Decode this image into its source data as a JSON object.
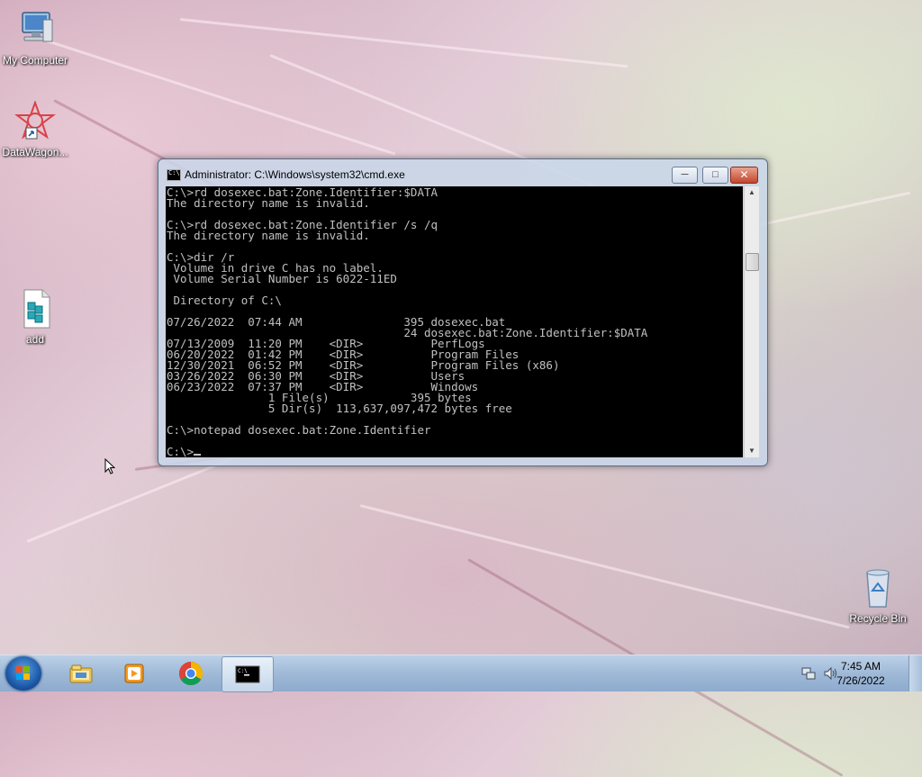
{
  "desktop": {
    "icons": [
      {
        "label": "My Computer",
        "icon": "computer-icon"
      },
      {
        "label": "DataWagon...",
        "icon": "datawagon-shortcut-icon"
      },
      {
        "label": "add",
        "icon": "registry-file-icon"
      },
      {
        "label": "Recycle Bin",
        "icon": "recycle-bin-icon"
      }
    ]
  },
  "cmd": {
    "title": "Administrator: C:\\Windows\\system32\\cmd.exe",
    "minimize": "─",
    "maximize": "□",
    "close": "✕",
    "lines": [
      "C:\\>rd dosexec.bat:Zone.Identifier:$DATA",
      "The directory name is invalid.",
      "",
      "C:\\>rd dosexec.bat:Zone.Identifier /s /q",
      "The directory name is invalid.",
      "",
      "C:\\>dir /r",
      " Volume in drive C has no label.",
      " Volume Serial Number is 6022-11ED",
      "",
      " Directory of C:\\",
      "",
      "07/26/2022  07:44 AM               395 dosexec.bat",
      "                                   24 dosexec.bat:Zone.Identifier:$DATA",
      "07/13/2009  11:20 PM    <DIR>          PerfLogs",
      "06/20/2022  01:42 PM    <DIR>          Program Files",
      "12/30/2021  06:52 PM    <DIR>          Program Files (x86)",
      "03/26/2022  06:30 PM    <DIR>          Users",
      "06/23/2022  07:37 PM    <DIR>          Windows",
      "               1 File(s)            395 bytes",
      "               5 Dir(s)  113,637,097,472 bytes free",
      "",
      "C:\\>notepad dosexec.bat:Zone.Identifier",
      ""
    ],
    "prompt": "C:\\>"
  },
  "taskbar": {
    "pinned": [
      {
        "name": "windows-explorer",
        "icon": "folder-icon"
      },
      {
        "name": "media-player",
        "icon": "media-player-icon"
      },
      {
        "name": "chrome",
        "icon": "chrome-icon"
      },
      {
        "name": "cmd",
        "icon": "cmd-icon",
        "active": true
      }
    ],
    "time": "7:45 AM",
    "date": "7/26/2022"
  },
  "colors": {
    "console_bg": "#000000",
    "console_fg": "#c0c0c0",
    "taskbar": "#9fb9d7",
    "close_button": "#c3462c"
  }
}
